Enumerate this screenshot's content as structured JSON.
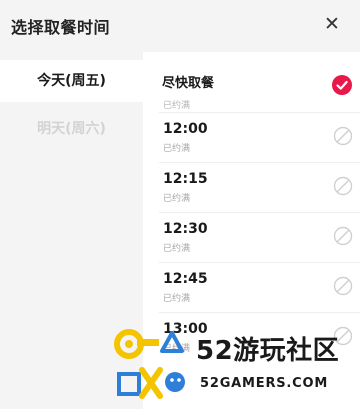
{
  "dialog": {
    "title": "选择取餐时间",
    "close_icon": "close-icon"
  },
  "days": [
    {
      "label": "今天(周五)",
      "selected": true
    },
    {
      "label": "明天(周六)",
      "selected": false
    }
  ],
  "asap": {
    "label": "尽快取餐",
    "selected": true,
    "check_color": "#e8184a"
  },
  "slots": [
    {
      "time": "12:00",
      "status": "已约满"
    },
    {
      "time": "12:15",
      "status": "已约满"
    },
    {
      "time": "12:30",
      "status": "已约满"
    },
    {
      "time": "12:45",
      "status": "已约满"
    },
    {
      "time": "13:00",
      "status": "已约满"
    }
  ],
  "cut_status": "已约满",
  "watermark": {
    "text": "52游玩社区",
    "url": "52GAMERS.COM"
  },
  "colors": {
    "accent": "#e8184a",
    "watermark_yellow": "#f5c400",
    "watermark_blue": "#2f7fd8"
  }
}
